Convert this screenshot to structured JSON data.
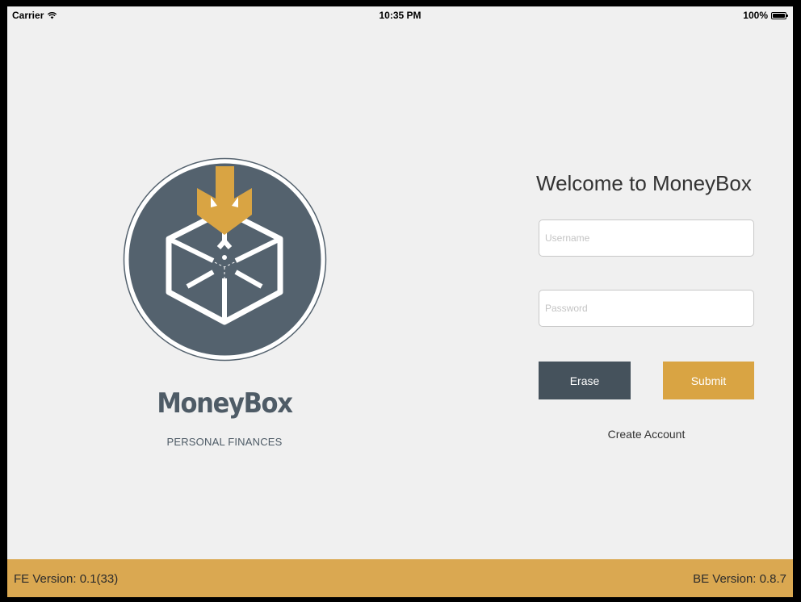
{
  "status_bar": {
    "carrier": "Carrier",
    "time": "10:35 PM",
    "battery": "100%"
  },
  "brand": {
    "name": "MoneyBox",
    "tagline": "PERSONAL FINANCES",
    "logo_icon": "box-arrow-icon",
    "colors": {
      "circle": "#54626e",
      "arrow": "#d9a443",
      "box": "#ffffff"
    }
  },
  "login": {
    "title": "Welcome to MoneyBox",
    "username": {
      "placeholder": "Username",
      "value": ""
    },
    "password": {
      "placeholder": "Password",
      "value": ""
    },
    "erase_label": "Erase",
    "submit_label": "Submit",
    "create_account_label": "Create Account"
  },
  "footer": {
    "fe_version": "FE Version: 0.1(33)",
    "be_version": "BE Version: 0.8.7"
  },
  "colors": {
    "accent": "#daa851",
    "dark_button": "#45525c",
    "background": "#f0f0f0"
  }
}
